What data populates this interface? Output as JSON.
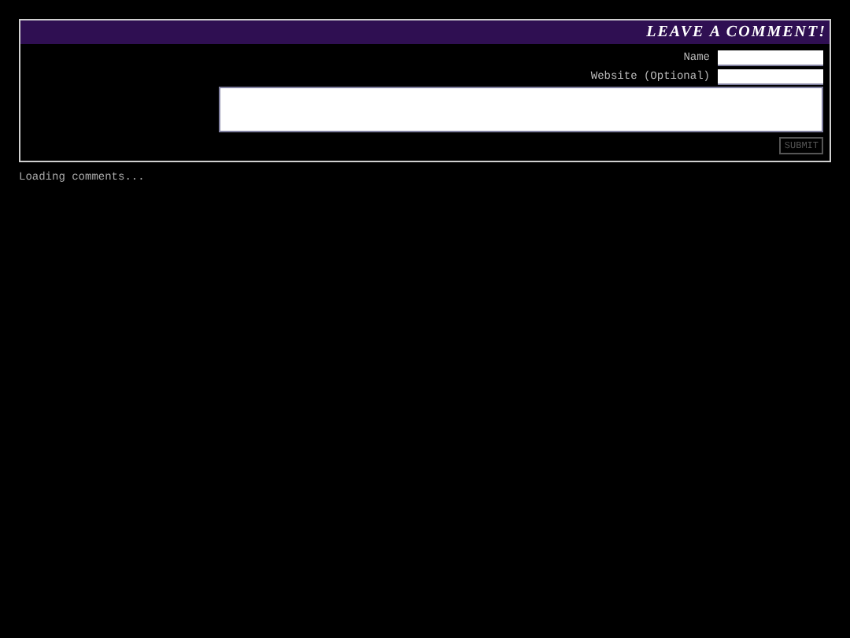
{
  "form": {
    "title": "LEAVE A COMMENT!",
    "fields": [
      {
        "label": "Name"
      },
      {
        "label": "Website (Optional)"
      }
    ],
    "submit": "SUBMIT"
  },
  "status": "Loading comments..."
}
